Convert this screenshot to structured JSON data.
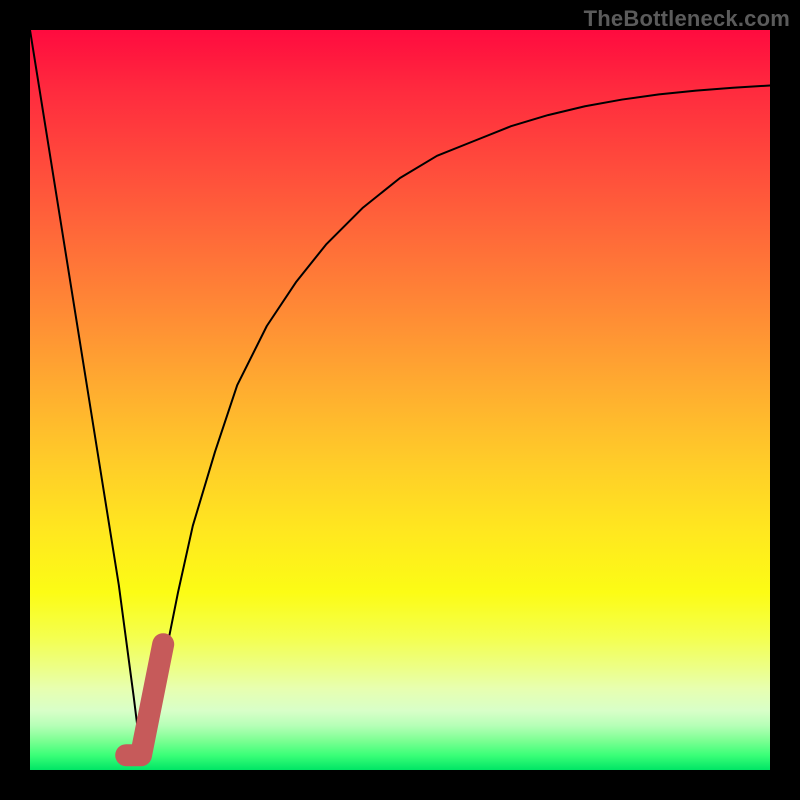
{
  "watermark": "TheBottleneck.com",
  "colors": {
    "frame": "#000000",
    "thin_line": "#000000",
    "thick_segment": "#c65a5a",
    "gradient_top": "#ff0b3f",
    "gradient_bottom": "#00e565"
  },
  "chart_data": {
    "type": "line",
    "title": "",
    "xlabel": "",
    "ylabel": "",
    "xlim": [
      0,
      100
    ],
    "ylim": [
      0,
      100
    ],
    "grid": false,
    "legend": false,
    "series": [
      {
        "name": "curve",
        "stroke": "#000000",
        "x": [
          0,
          4,
          8,
          12,
          14,
          15,
          16,
          18,
          20,
          22,
          25,
          28,
          32,
          36,
          40,
          45,
          50,
          55,
          60,
          65,
          70,
          75,
          80,
          85,
          90,
          95,
          100
        ],
        "y": [
          100,
          75,
          50,
          25,
          10,
          2,
          4,
          14,
          24,
          33,
          43,
          52,
          60,
          66,
          71,
          76,
          80,
          83,
          85,
          87,
          88.5,
          89.7,
          90.6,
          91.3,
          91.8,
          92.2,
          92.5
        ]
      },
      {
        "name": "highlight",
        "stroke": "#c65a5a",
        "x": [
          13,
          15,
          18
        ],
        "y": [
          2,
          2,
          17
        ]
      }
    ],
    "annotations": []
  }
}
